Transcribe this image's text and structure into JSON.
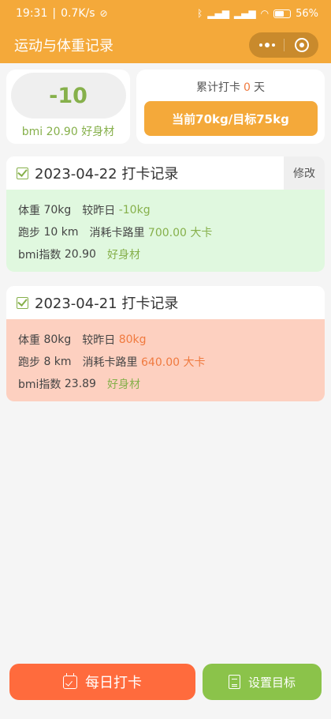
{
  "statusbar": {
    "time": "19:31",
    "speed": "0.7K/s",
    "separator": "|",
    "battery": "56"
  },
  "navbar": {
    "title": "运动与体重记录"
  },
  "summary": {
    "diff": "-10",
    "bmi_label": "bmi",
    "bmi_value": "20.90",
    "bmi_status": "好身材",
    "streak_prefix": "累计打卡",
    "streak_count": "0",
    "streak_suffix": "天",
    "target_button": "当前70kg/目标75kg"
  },
  "records": [
    {
      "date": "2023-04-22",
      "title_suffix": "打卡记录",
      "edit_label": "修改",
      "weight_label": "体重",
      "weight": "70kg",
      "compare_label": "较昨日",
      "compare": "-10kg",
      "run_label": "跑步",
      "run": "10 km",
      "calorie_label": "消耗卡路里",
      "calorie": "700.00 大卡",
      "bmi_label": "bmi指数",
      "bmi": "20.90",
      "bmi_status": "好身材"
    },
    {
      "date": "2023-04-21",
      "title_suffix": "打卡记录",
      "weight_label": "体重",
      "weight": "80kg",
      "compare_label": "较昨日",
      "compare": "80kg",
      "run_label": "跑步",
      "run": "8 km",
      "calorie_label": "消耗卡路里",
      "calorie": "640.00 大卡",
      "bmi_label": "bmi指数",
      "bmi": "23.89",
      "bmi_status": "好身材"
    }
  ],
  "actions": {
    "checkin": "每日打卡",
    "set_goal": "设置目标"
  },
  "colors": {
    "primary": "#f4a93a",
    "accent_green": "#86b04b",
    "accent_orange": "#f07a3f",
    "checkin_button": "#ff6b3d",
    "goal_button": "#8bc34a",
    "record_good_bg": "#e0f8df",
    "record_bad_bg": "#fdd0c0"
  }
}
